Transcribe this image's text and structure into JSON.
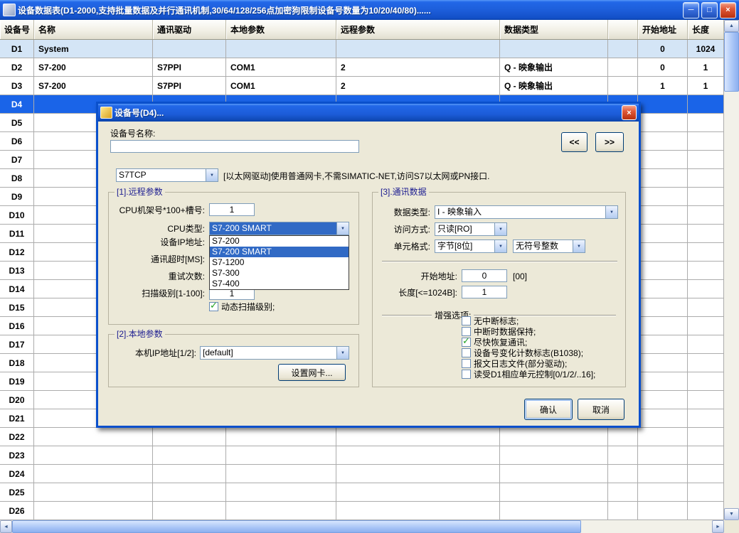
{
  "icons": {
    "minimize": "─",
    "maximize": "□",
    "close": "×",
    "up": "▲",
    "down": "▼",
    "left": "◄",
    "right": "►",
    "combo": "▼",
    "check": "✓"
  },
  "colors": {
    "titlebar_blue": "#1c5cd8",
    "selection_row": "#1a64e8",
    "highlight": "#316ac5",
    "dialog_bg": "#ece9d8",
    "check_green": "#21a121"
  },
  "window": {
    "title": "设备数据表(D1-2000,支持批量数据及并行通讯机制,30/64/128/256点加密狗限制设备号数量为10/20/40/80)......"
  },
  "table": {
    "columns": [
      "设备号",
      "名称",
      "通讯驱动",
      "本地参数",
      "远程参数",
      "数据类型",
      "",
      "开始地址",
      "长度"
    ],
    "rows": [
      {
        "id": "D1",
        "name": "System",
        "driver": "",
        "local": "",
        "remote": "",
        "dtype": "",
        "extra": "",
        "start": "0",
        "length": "1024",
        "state": "system"
      },
      {
        "id": "D2",
        "name": "S7-200",
        "driver": "S7PPI",
        "local": "COM1",
        "remote": "2",
        "dtype": "Q - 映象输出",
        "extra": "",
        "start": "0",
        "length": "1",
        "state": ""
      },
      {
        "id": "D3",
        "name": "S7-200",
        "driver": "S7PPI",
        "local": "COM1",
        "remote": "2",
        "dtype": "Q - 映象输出",
        "extra": "",
        "start": "1",
        "length": "1",
        "state": ""
      },
      {
        "id": "D4",
        "name": "",
        "driver": "",
        "local": "",
        "remote": "",
        "dtype": "",
        "extra": "",
        "start": "",
        "length": "",
        "state": "selected"
      },
      {
        "id": "D5",
        "name": "",
        "driver": "",
        "local": "",
        "remote": "",
        "dtype": "",
        "extra": "",
        "start": "",
        "length": "",
        "state": ""
      },
      {
        "id": "D6",
        "name": "",
        "driver": "",
        "local": "",
        "remote": "",
        "dtype": "",
        "extra": "",
        "start": "",
        "length": "",
        "state": ""
      },
      {
        "id": "D7",
        "name": "",
        "driver": "",
        "local": "",
        "remote": "",
        "dtype": "",
        "extra": "",
        "start": "",
        "length": "",
        "state": ""
      },
      {
        "id": "D8",
        "name": "",
        "driver": "",
        "local": "",
        "remote": "",
        "dtype": "",
        "extra": "",
        "start": "",
        "length": "",
        "state": ""
      },
      {
        "id": "D9",
        "name": "",
        "driver": "",
        "local": "",
        "remote": "",
        "dtype": "",
        "extra": "",
        "start": "",
        "length": "",
        "state": ""
      },
      {
        "id": "D10",
        "name": "",
        "driver": "",
        "local": "",
        "remote": "",
        "dtype": "",
        "extra": "",
        "start": "",
        "length": "",
        "state": ""
      },
      {
        "id": "D11",
        "name": "",
        "driver": "",
        "local": "",
        "remote": "",
        "dtype": "",
        "extra": "",
        "start": "",
        "length": "",
        "state": ""
      },
      {
        "id": "D12",
        "name": "",
        "driver": "",
        "local": "",
        "remote": "",
        "dtype": "",
        "extra": "",
        "start": "",
        "length": "",
        "state": ""
      },
      {
        "id": "D13",
        "name": "",
        "driver": "",
        "local": "",
        "remote": "",
        "dtype": "",
        "extra": "",
        "start": "",
        "length": "",
        "state": ""
      },
      {
        "id": "D14",
        "name": "",
        "driver": "",
        "local": "",
        "remote": "",
        "dtype": "",
        "extra": "",
        "start": "",
        "length": "",
        "state": ""
      },
      {
        "id": "D15",
        "name": "",
        "driver": "",
        "local": "",
        "remote": "",
        "dtype": "",
        "extra": "",
        "start": "",
        "length": "",
        "state": ""
      },
      {
        "id": "D16",
        "name": "",
        "driver": "",
        "local": "",
        "remote": "",
        "dtype": "",
        "extra": "",
        "start": "",
        "length": "",
        "state": ""
      },
      {
        "id": "D17",
        "name": "",
        "driver": "",
        "local": "",
        "remote": "",
        "dtype": "",
        "extra": "",
        "start": "",
        "length": "",
        "state": ""
      },
      {
        "id": "D18",
        "name": "",
        "driver": "",
        "local": "",
        "remote": "",
        "dtype": "",
        "extra": "",
        "start": "",
        "length": "",
        "state": ""
      },
      {
        "id": "D19",
        "name": "",
        "driver": "",
        "local": "",
        "remote": "",
        "dtype": "",
        "extra": "",
        "start": "",
        "length": "",
        "state": ""
      },
      {
        "id": "D20",
        "name": "",
        "driver": "",
        "local": "",
        "remote": "",
        "dtype": "",
        "extra": "",
        "start": "",
        "length": "",
        "state": ""
      },
      {
        "id": "D21",
        "name": "",
        "driver": "",
        "local": "",
        "remote": "",
        "dtype": "",
        "extra": "",
        "start": "",
        "length": "",
        "state": ""
      },
      {
        "id": "D22",
        "name": "",
        "driver": "",
        "local": "",
        "remote": "",
        "dtype": "",
        "extra": "",
        "start": "",
        "length": "",
        "state": ""
      },
      {
        "id": "D23",
        "name": "",
        "driver": "",
        "local": "",
        "remote": "",
        "dtype": "",
        "extra": "",
        "start": "",
        "length": "",
        "state": ""
      },
      {
        "id": "D24",
        "name": "",
        "driver": "",
        "local": "",
        "remote": "",
        "dtype": "",
        "extra": "",
        "start": "",
        "length": "",
        "state": ""
      },
      {
        "id": "D25",
        "name": "",
        "driver": "",
        "local": "",
        "remote": "",
        "dtype": "",
        "extra": "",
        "start": "",
        "length": "",
        "state": ""
      },
      {
        "id": "D26",
        "name": "",
        "driver": "",
        "local": "",
        "remote": "",
        "dtype": "",
        "extra": "",
        "start": "",
        "length": "",
        "state": ""
      }
    ]
  },
  "dialog": {
    "title": "设备号(D4)...",
    "name_label": "设备号名称:",
    "name_value": "",
    "nav_prev": "<<",
    "nav_next": ">>",
    "driver_value": "S7TCP",
    "driver_desc": "[以太网驱动]使用普通网卡,不需SIMATIC-NET,访问S7以太网或PN接口.",
    "group1": {
      "title": "[1].远程参数",
      "rack_label": "CPU机架号*100+槽号:",
      "rack_value": "1",
      "cpu_label": "CPU类型:",
      "cpu_value": "S7-200 SMART",
      "cpu_options": [
        "S7-200",
        "S7-200 SMART",
        "S7-1200",
        "S7-300",
        "S7-400"
      ],
      "ip_label": "设备IP地址:",
      "timeout_label": "通讯超时[MS]:",
      "retry_label": "重试次数:",
      "scan_label": "扫描级别[1-100]:",
      "scan_value": "1",
      "dynamic_scan_label": "动态扫描级别;",
      "dynamic_scan_checked": true
    },
    "group2": {
      "title": "[2].本地参数",
      "local_ip_label": "本机IP地址[1/2]:",
      "local_ip_value": "[default]",
      "nic_button": "设置网卡..."
    },
    "group3": {
      "title": "[3].通讯数据",
      "dtype_label": "数据类型:",
      "dtype_value": "I - 映象输入",
      "access_label": "访问方式:",
      "access_value": "只读[RO]",
      "unit_label": "单元格式:",
      "unit_value": "字节[8位]",
      "unit_value2": "无符号整数",
      "start_label": "开始地址:",
      "start_value": "0",
      "start_hint": "[00]",
      "length_label": "长度[<=1024B]:",
      "length_value": "1",
      "enhanced_label": "增强选项:",
      "options": [
        {
          "label": "无中断标志;",
          "checked": false
        },
        {
          "label": "中断时数据保持;",
          "checked": false
        },
        {
          "label": "尽快恢复通讯;",
          "checked": true
        },
        {
          "label": "设备号变化计数标志(B1038);",
          "checked": false
        },
        {
          "label": "报文日志文件(部分驱动);",
          "checked": false
        },
        {
          "label": "读受D1相应单元控制[0/1/2/..16];",
          "checked": false
        }
      ]
    },
    "ok_button": "确认",
    "cancel_button": "取消"
  }
}
